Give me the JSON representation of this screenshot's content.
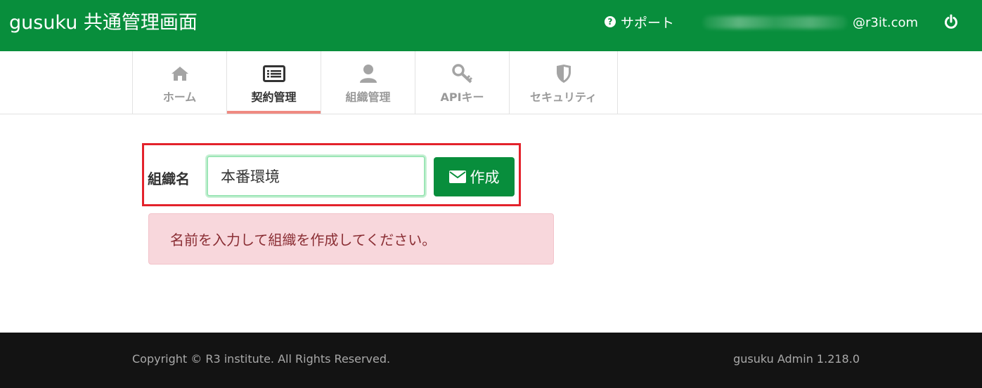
{
  "header": {
    "title": "gusuku 共通管理画面",
    "support_label": "サポート",
    "user_email_visible": "@r3it.com",
    "background_color": "#088e3c"
  },
  "tabs": [
    {
      "label": "ホーム",
      "icon": "home-icon",
      "active": false
    },
    {
      "label": "契約管理",
      "icon": "list-icon",
      "active": true
    },
    {
      "label": "組織管理",
      "icon": "user-icon",
      "active": false
    },
    {
      "label": "APIキー",
      "icon": "key-icon",
      "active": false
    },
    {
      "label": "セキュリティ",
      "icon": "shield-icon",
      "active": false
    }
  ],
  "form": {
    "org_label": "組織名",
    "org_value": "本番環境",
    "create_button": "作成"
  },
  "alert": {
    "message": "名前を入力して組織を作成してください。"
  },
  "footer": {
    "copyright": "Copyright © R3 institute. All Rights Reserved.",
    "version": "gusuku Admin 1.218.0"
  },
  "colors": {
    "brand_green": "#088e3c",
    "active_tab_underline": "#ef8a82",
    "highlight_border": "#e3222b",
    "alert_bg": "#f8d7dc"
  }
}
